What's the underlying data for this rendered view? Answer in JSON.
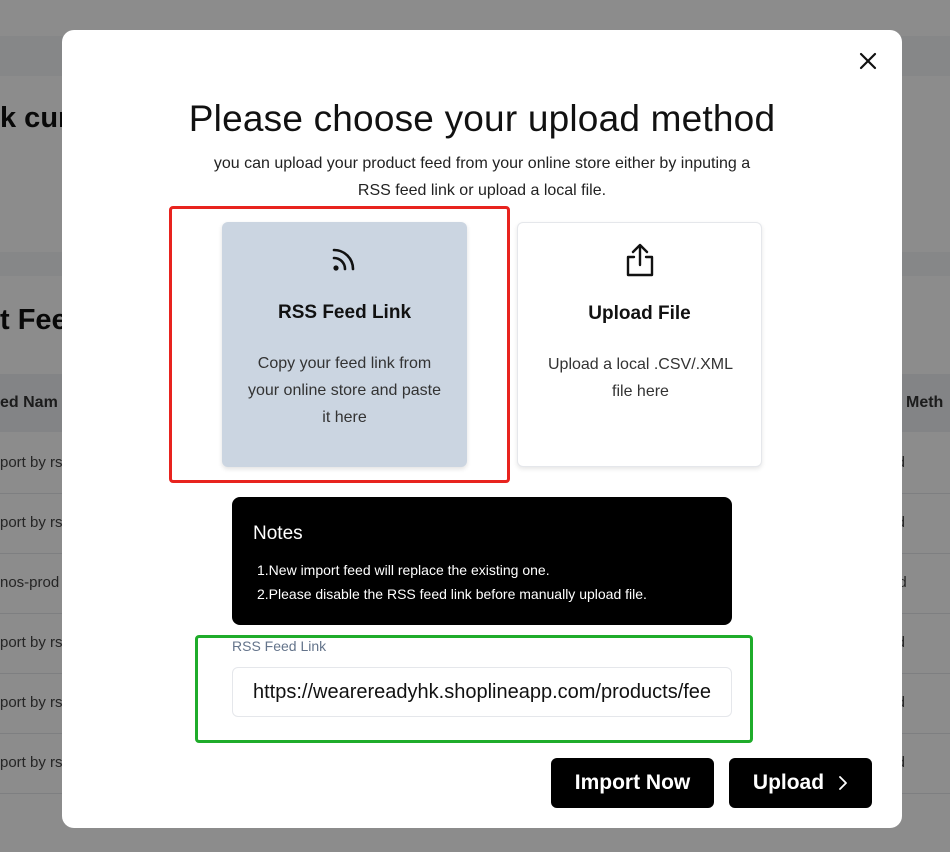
{
  "background": {
    "card1_heading": "k cur",
    "card2_heading": "t Fee",
    "table_header_left": "ed Nam",
    "table_header_right": "Meth",
    "rows": [
      {
        "left": "port by rs",
        "right": "oad"
      },
      {
        "left": "port by rs",
        "right": "oad"
      },
      {
        "left": "nos-prod",
        "right": "pload"
      },
      {
        "left": "port by rs",
        "right": "oad"
      },
      {
        "left": "port by rs",
        "right": "oad"
      },
      {
        "left": "port by rs",
        "right": "oad"
      }
    ]
  },
  "modal": {
    "title": "Please choose your upload method",
    "subtitle": "you can upload your product feed from your online store either by inputing a RSS feed link or upload a local file.",
    "options": [
      {
        "icon": "rss-icon",
        "title": "RSS Feed Link",
        "description": "Copy your feed link from your online store and paste it here",
        "selected": true
      },
      {
        "icon": "share-upload-icon",
        "title": "Upload File",
        "description": "Upload a local .CSV/.XML file here",
        "selected": false
      }
    ],
    "notes": {
      "title": "Notes",
      "lines": [
        "1.New import feed will replace the existing one.",
        "2.Please disable the RSS feed link before manually upload file."
      ]
    },
    "rss_field": {
      "label": "RSS Feed Link",
      "value": "https://wearereadyhk.shoplineapp.com/products/feed.xml"
    },
    "buttons": {
      "import_label": "Import Now",
      "upload_label": "Upload"
    }
  },
  "colors": {
    "overlay": "#000000",
    "selected_option": "#cbd5e1",
    "highlight_red": "#e8231e",
    "highlight_green": "#1fac2a",
    "button_bg": "#000000"
  }
}
